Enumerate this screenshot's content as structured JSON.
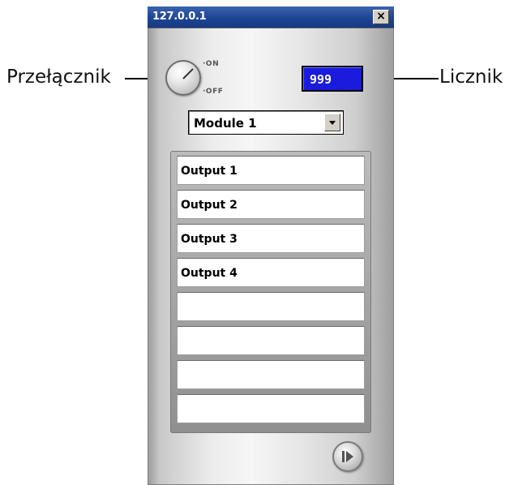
{
  "callouts": {
    "switch_label": "Przełącznik",
    "counter_label": "Licznik"
  },
  "window": {
    "title": "127.0.0.1",
    "close_glyph": "×"
  },
  "switch": {
    "on_label": "·ON",
    "off_label": "·OFF",
    "state": "OFF"
  },
  "counter": {
    "value": "999"
  },
  "module_select": {
    "selected": "Module 1"
  },
  "outputs": [
    {
      "label": "Output 1"
    },
    {
      "label": "Output 2"
    },
    {
      "label": "Output 3"
    },
    {
      "label": "Output 4"
    },
    {
      "label": ""
    },
    {
      "label": ""
    },
    {
      "label": ""
    },
    {
      "label": ""
    }
  ],
  "icons": {
    "close": "close-icon",
    "dropdown": "chevron-down-icon",
    "play": "play-icon"
  },
  "colors": {
    "titlebar": "#1f4493",
    "counter_bg": "#1a1bdc",
    "counter_text": "#ffffff"
  }
}
